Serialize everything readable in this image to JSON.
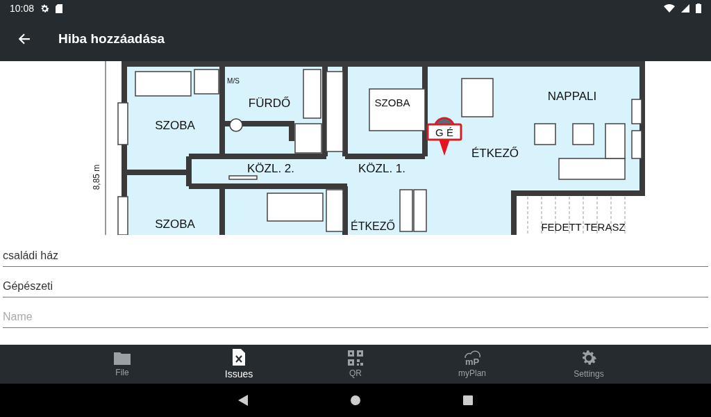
{
  "status_bar": {
    "time": "10:08"
  },
  "app_bar": {
    "title": "Hiba hozzáadása"
  },
  "floor_plan": {
    "dimension": "8,85 m",
    "rooms": [
      {
        "name": "SZOBA"
      },
      {
        "name": "M/S"
      },
      {
        "name": "FÜRDŐ"
      },
      {
        "name": "SZOBA"
      },
      {
        "name": "KÖZL. 2."
      },
      {
        "name": "KÖZL. 1."
      },
      {
        "name": "SZOBA"
      },
      {
        "name": "ÉTKEZŐ"
      },
      {
        "name": "ÉTKEZŐ"
      },
      {
        "name": "NAPPALI"
      },
      {
        "name": "FEDETT TERASZ"
      }
    ],
    "marker": {
      "label": "G É"
    }
  },
  "fields": [
    {
      "value": "családi ház"
    },
    {
      "value": "Gépészeti"
    },
    {
      "placeholder": "Name"
    }
  ],
  "bottom_nav": [
    {
      "label": "File",
      "kind": "folder",
      "selected": false
    },
    {
      "label": "Issues",
      "kind": "issues",
      "selected": true
    },
    {
      "label": "QR",
      "kind": "qr",
      "selected": false
    },
    {
      "label": "myPlan",
      "kind": "myplan",
      "icon_text": "mP",
      "selected": false
    },
    {
      "label": "Settings",
      "kind": "settings",
      "selected": false
    }
  ]
}
